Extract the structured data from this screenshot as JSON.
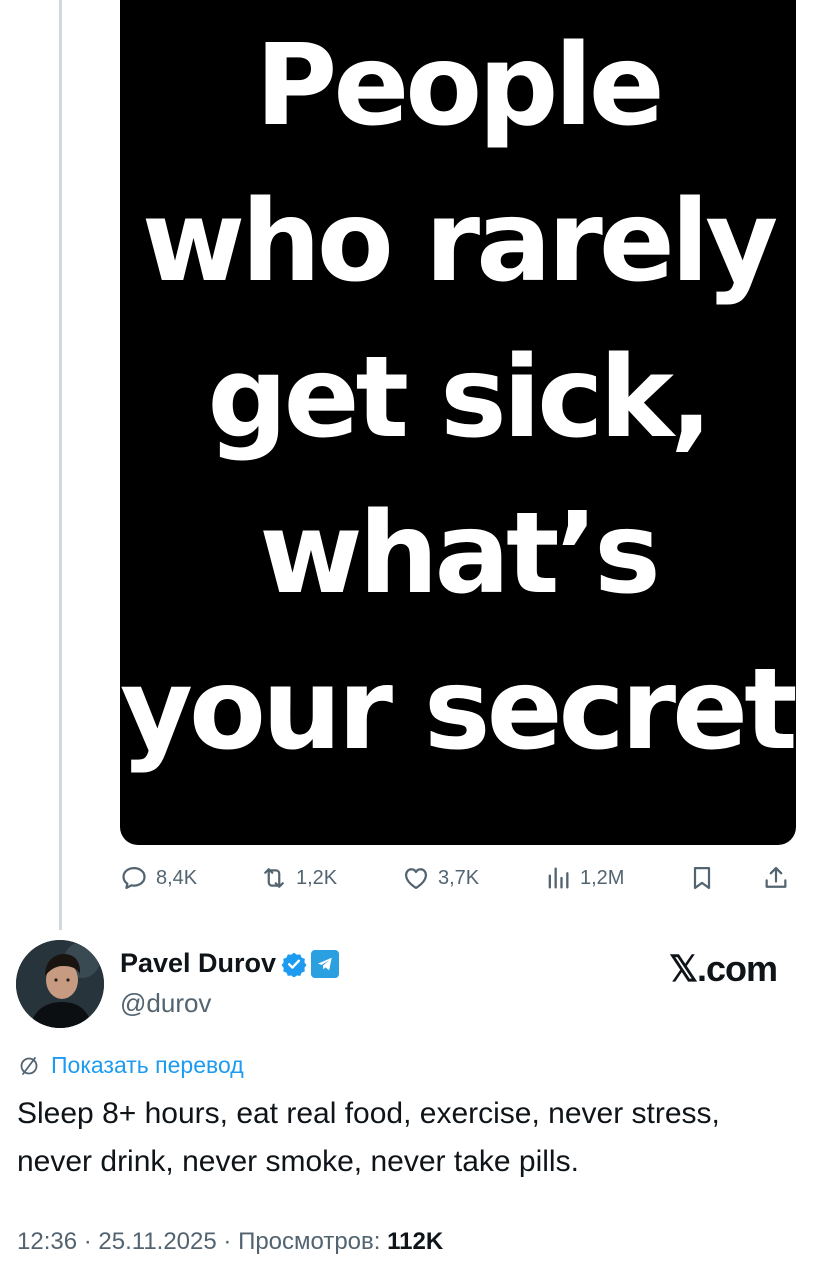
{
  "media": {
    "lines": [
      "People",
      "who rarely",
      "get sick,",
      "what’s",
      "your secret?"
    ]
  },
  "actions": {
    "replies": "8,4K",
    "reposts": "1,2K",
    "likes": "3,7K",
    "views": "1,2M",
    "icons": [
      "reply-icon",
      "repost-icon",
      "like-icon",
      "views-icon",
      "bookmark-icon",
      "share-icon"
    ]
  },
  "author": {
    "name": "Pavel Durov",
    "handle": "@durov",
    "badges": [
      "verified-icon",
      "telegram-icon"
    ]
  },
  "brand": {
    "label": "𝕏.com"
  },
  "translate": {
    "label": "Показать перевод"
  },
  "tweet": {
    "text": "Sleep 8+ hours, eat real food, exercise, never stress, never drink, never smoke, never take pills."
  },
  "meta": {
    "time": "12:36",
    "sep1": " · ",
    "date": "25.11.2025",
    "sep2": " · ",
    "views_label": "Просмотров: ",
    "views_count": "112K"
  },
  "colors": {
    "accent": "#1d9bf0",
    "muted": "#536471",
    "text": "#0f1419",
    "media_bg": "#000000"
  }
}
